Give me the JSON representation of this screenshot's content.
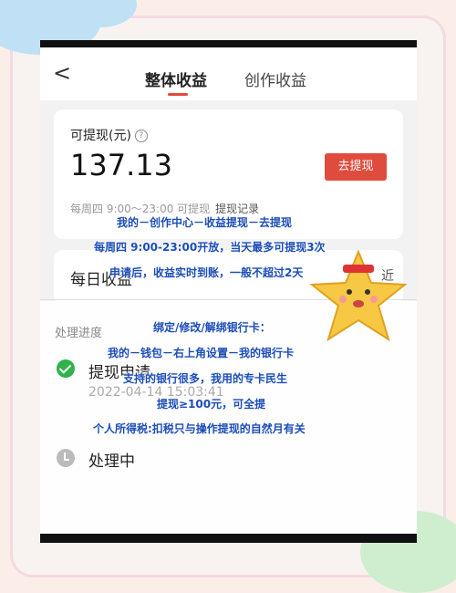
{
  "header": {
    "back_glyph": "<",
    "tab_active": "整体收益",
    "tab_inactive": "创作收益"
  },
  "balance": {
    "label": "可提现(元)",
    "help_glyph": "?",
    "amount": "137.13",
    "button": "去提现",
    "note": "每周四 9:00～23:00 可提现",
    "record_link": "提现记录"
  },
  "daily": {
    "title": "每日收益",
    "right": "近"
  },
  "progress": {
    "title": "处理进度",
    "steps": [
      {
        "label": "提现申请",
        "time": "2022-04-14 15:03:41",
        "status": "done"
      },
      {
        "label": "处理中",
        "status": "pending"
      }
    ]
  },
  "annotations": [
    "我的－创作中心－收益提现－去提现",
    "每周四 9:00-23:00开放，当天最多可提现3次",
    "申请后，收益实时到账，一般不超过2天",
    "绑定/修改/解绑银行卡：",
    "我的－钱包－右上角设置－我的银行卡",
    "支持的银行很多，我用的专卡民生",
    "提现≥100元，可全提",
    "个人所得税:扣税只与操作提现的自然月有关"
  ],
  "colors": {
    "accent": "#df4c3e",
    "success": "#2fb24a",
    "annotation": "#1c4db8"
  }
}
